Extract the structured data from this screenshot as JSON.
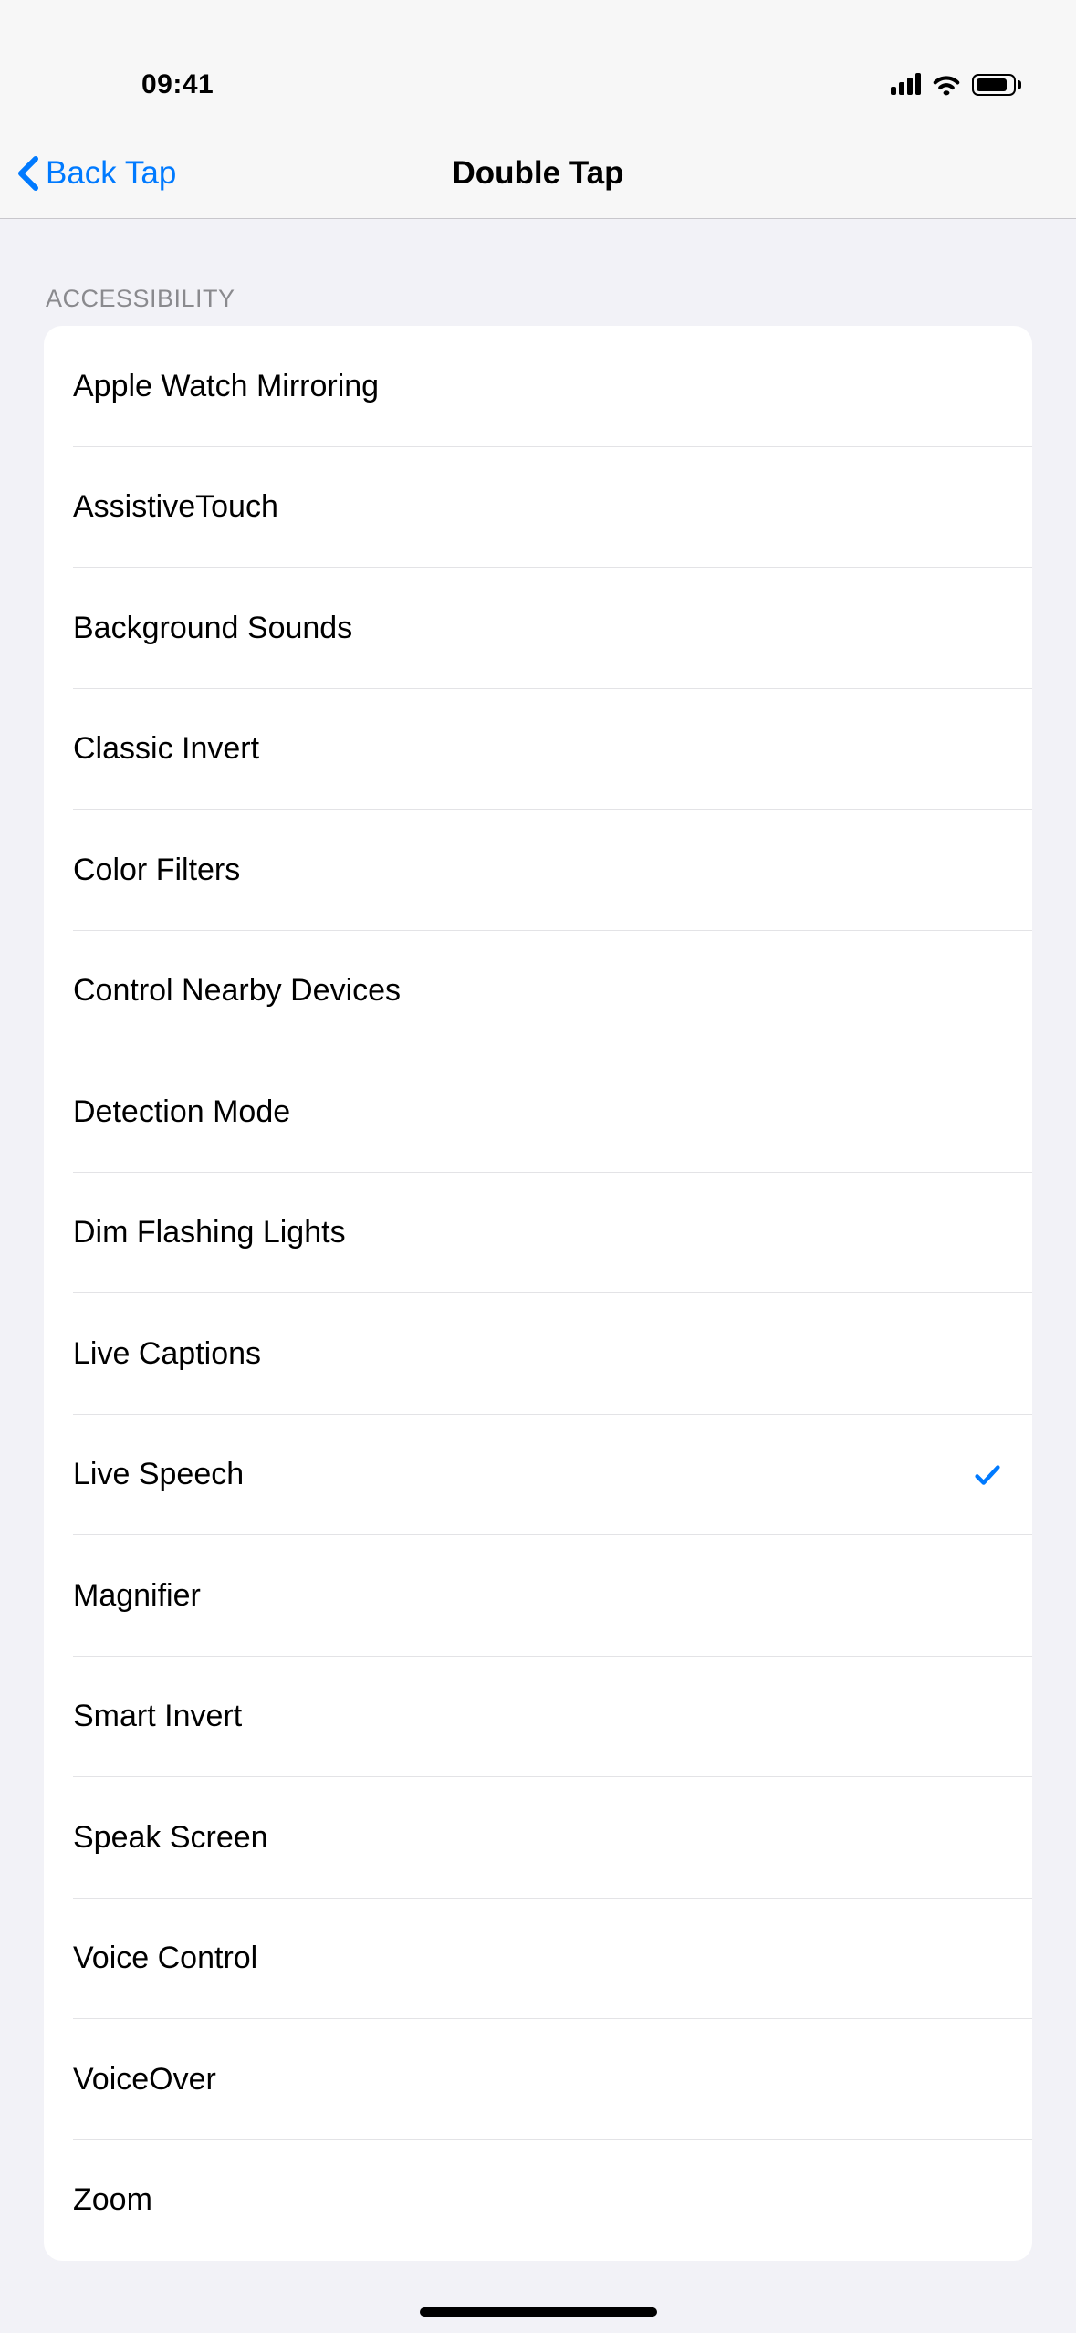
{
  "status_bar": {
    "time": "09:41"
  },
  "nav": {
    "back_label": "Back Tap",
    "title": "Double Tap"
  },
  "section": {
    "header": "ACCESSIBILITY"
  },
  "items": [
    {
      "label": "Apple Watch Mirroring",
      "selected": false
    },
    {
      "label": "AssistiveTouch",
      "selected": false
    },
    {
      "label": "Background Sounds",
      "selected": false
    },
    {
      "label": "Classic Invert",
      "selected": false
    },
    {
      "label": "Color Filters",
      "selected": false
    },
    {
      "label": "Control Nearby Devices",
      "selected": false
    },
    {
      "label": "Detection Mode",
      "selected": false
    },
    {
      "label": "Dim Flashing Lights",
      "selected": false
    },
    {
      "label": "Live Captions",
      "selected": false
    },
    {
      "label": "Live Speech",
      "selected": true
    },
    {
      "label": "Magnifier",
      "selected": false
    },
    {
      "label": "Smart Invert",
      "selected": false
    },
    {
      "label": "Speak Screen",
      "selected": false
    },
    {
      "label": "Voice Control",
      "selected": false
    },
    {
      "label": "VoiceOver",
      "selected": false
    },
    {
      "label": "Zoom",
      "selected": false
    }
  ],
  "colors": {
    "accent": "#007aff",
    "background": "#f2f2f7",
    "list_bg": "#ffffff"
  }
}
